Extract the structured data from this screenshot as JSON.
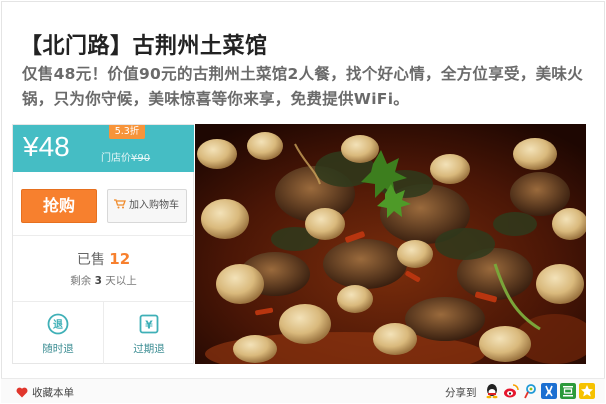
{
  "deal": {
    "title": "【北门路】古荆州土菜馆",
    "subtitle": "仅售48元！价值90元的古荆州土菜馆2人餐，找个好心情，全方位享受，美味火锅，只为你守候，美味惊喜等你来享，免费提供WiFi。"
  },
  "price_panel": {
    "price": "¥48",
    "discount_badge": "5.3折",
    "original_label": "门店价",
    "original_price": "¥90",
    "buy_label": "抢购",
    "cart_label": "加入购物车",
    "sold_label": "已售",
    "sold_count": "12",
    "remain_prefix": "剩余",
    "remain_days": "3",
    "remain_suffix": "天以上",
    "guarantee_refund_anytime": "随时退",
    "guarantee_refund_expired": "过期退",
    "refund_anytime_glyph": "退",
    "refund_expired_glyph": "¥"
  },
  "footer": {
    "favorite_label": "收藏本单",
    "share_label": "分享到"
  },
  "colors": {
    "price_bar": "#45bdc4",
    "buy_button": "#f7802e",
    "discount_badge": "#f7943a",
    "sold_count": "#f7802e"
  },
  "icons": {
    "cart": "shopping-cart-icon",
    "heart": "heart-icon",
    "refund_anytime": "refund-circle-icon",
    "refund_expired": "refund-yen-icon",
    "share": [
      "qq-icon",
      "weibo-icon",
      "tencent-weibo-icon",
      "renren-icon",
      "douban-icon",
      "qzone-icon"
    ]
  }
}
